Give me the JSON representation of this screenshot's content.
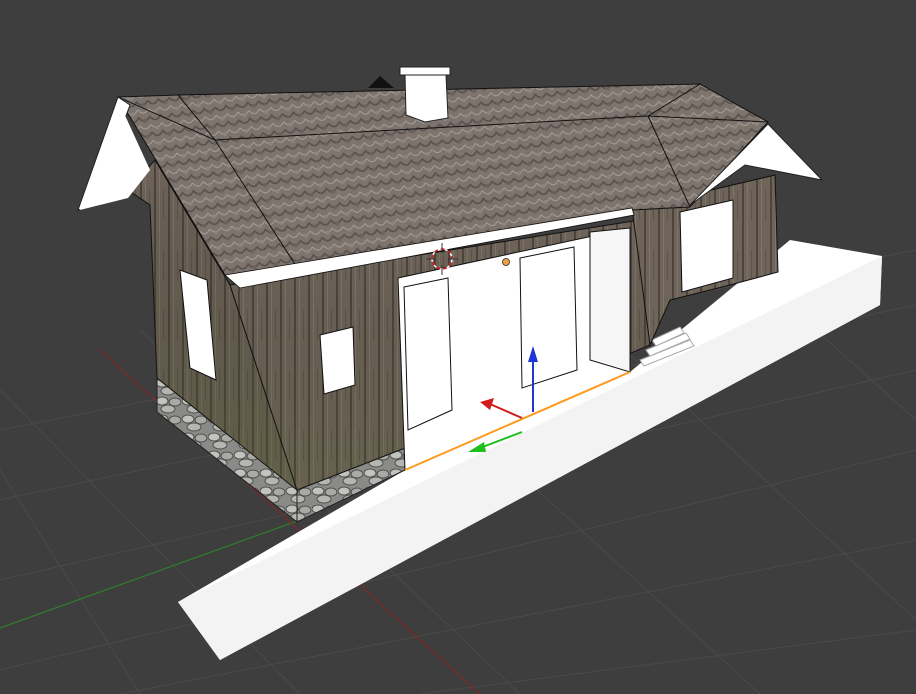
{
  "viewport": {
    "view": "3D Viewport",
    "background_color": "#3e3e3e",
    "grid_color": "#4a4a4a",
    "x_axis_color": "#7a2a2a",
    "y_axis_color": "#2f7a2f"
  },
  "scene": {
    "object": "station-building",
    "selected_edge_color": "#ff9a1f",
    "cursor": "3d-cursor-icon",
    "gizmo": {
      "x_color": "#d21c1c",
      "y_color": "#1fbf1f",
      "z_color": "#1f35d6"
    }
  }
}
